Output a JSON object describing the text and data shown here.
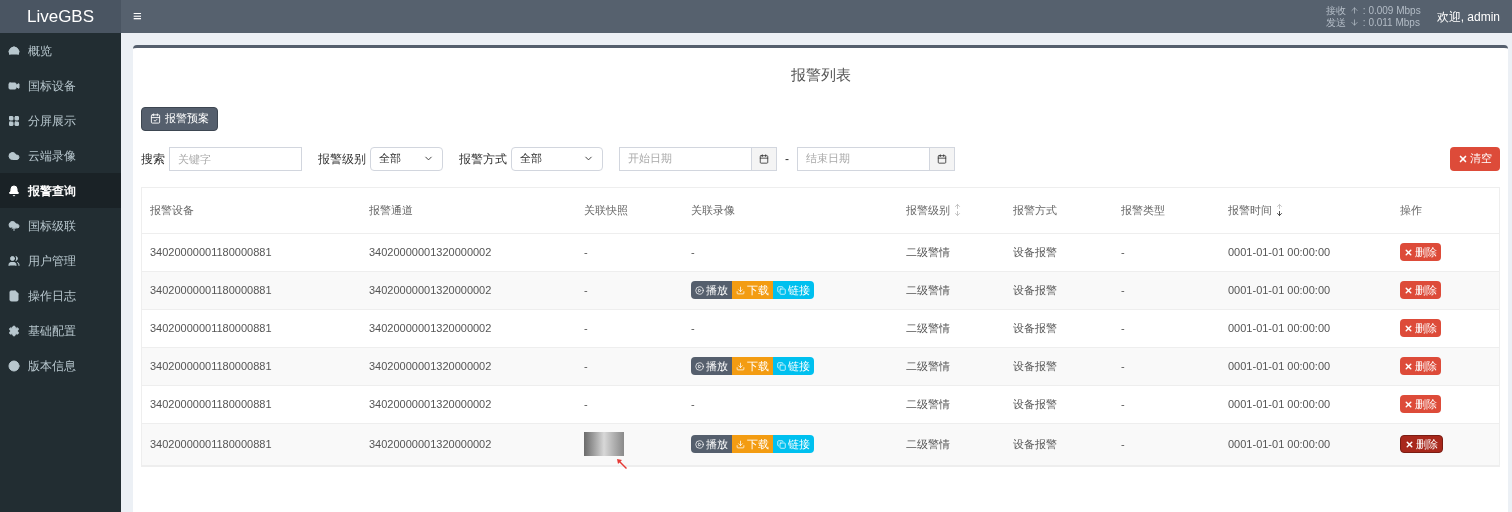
{
  "brand": "LiveGBS",
  "header": {
    "menu_icon": "≡",
    "rx_label": "接收",
    "rx_value": ": 0.009 Mbps",
    "tx_label": "发送",
    "tx_value": ": 0.011 Mbps",
    "user": "欢迎, admin"
  },
  "sidebar": {
    "items": [
      {
        "label": "概览",
        "selected": false
      },
      {
        "label": "国标设备",
        "selected": false
      },
      {
        "label": "分屏展示",
        "selected": false
      },
      {
        "label": "云端录像",
        "selected": false
      },
      {
        "label": "报警查询",
        "selected": true
      },
      {
        "label": "国标级联",
        "selected": false
      },
      {
        "label": "用户管理",
        "selected": false
      },
      {
        "label": "操作日志",
        "selected": false
      },
      {
        "label": "基础配置",
        "selected": false
      },
      {
        "label": "版本信息",
        "selected": false
      }
    ]
  },
  "page": {
    "title": "报警列表",
    "plan_button": "报警预案",
    "clear_button": "清空",
    "filters": {
      "search_label": "搜索",
      "search_placeholder": "关键字",
      "level_label": "报警级别",
      "level_value": "全部",
      "method_label": "报警方式",
      "method_value": "全部",
      "start_placeholder": "开始日期",
      "range_sep": "-",
      "end_placeholder": "结束日期"
    }
  },
  "table": {
    "columns": [
      {
        "label": "报警设备",
        "kind": "plain"
      },
      {
        "label": "报警通道",
        "kind": "plain"
      },
      {
        "label": "关联快照",
        "kind": "plain"
      },
      {
        "label": "关联录像",
        "kind": "plain"
      },
      {
        "label": "报警级别",
        "kind": "sortable"
      },
      {
        "label": "报警方式",
        "kind": "plain"
      },
      {
        "label": "报警类型",
        "kind": "plain"
      },
      {
        "label": "报警时间",
        "kind": "sorted"
      },
      {
        "label": "操作",
        "kind": "plain"
      }
    ],
    "rows": [
      {
        "device": "34020000001180000881",
        "channel": "34020000001320000002",
        "snapshot": {
          "kind": "none",
          "text": "-"
        },
        "recording": {
          "kind": "none",
          "text": "-"
        },
        "level": "二级警情",
        "method": "设备报警",
        "type": "-",
        "time": "0001-01-01 00:00:00",
        "delete": "删除",
        "delete_hover": false
      },
      {
        "device": "34020000001180000881",
        "channel": "34020000001320000002",
        "snapshot": {
          "kind": "none",
          "text": "-"
        },
        "recording": {
          "kind": "buttons",
          "play": "播放",
          "download": "下载",
          "link": "链接"
        },
        "level": "二级警情",
        "method": "设备报警",
        "type": "-",
        "time": "0001-01-01 00:00:00",
        "delete": "删除",
        "delete_hover": false
      },
      {
        "device": "34020000001180000881",
        "channel": "34020000001320000002",
        "snapshot": {
          "kind": "none",
          "text": "-"
        },
        "recording": {
          "kind": "none",
          "text": "-"
        },
        "level": "二级警情",
        "method": "设备报警",
        "type": "-",
        "time": "0001-01-01 00:00:00",
        "delete": "删除",
        "delete_hover": false
      },
      {
        "device": "34020000001180000881",
        "channel": "34020000001320000002",
        "snapshot": {
          "kind": "none",
          "text": "-"
        },
        "recording": {
          "kind": "buttons",
          "play": "播放",
          "download": "下载",
          "link": "链接"
        },
        "level": "二级警情",
        "method": "设备报警",
        "type": "-",
        "time": "0001-01-01 00:00:00",
        "delete": "删除",
        "delete_hover": false
      },
      {
        "device": "34020000001180000881",
        "channel": "34020000001320000002",
        "snapshot": {
          "kind": "none",
          "text": "-"
        },
        "recording": {
          "kind": "none",
          "text": "-"
        },
        "level": "二级警情",
        "method": "设备报警",
        "type": "-",
        "time": "0001-01-01 00:00:00",
        "delete": "删除",
        "delete_hover": false
      },
      {
        "device": "34020000001180000881",
        "channel": "34020000001320000002",
        "snapshot": {
          "kind": "image"
        },
        "recording": {
          "kind": "buttons",
          "play": "播放",
          "download": "下载",
          "link": "链接"
        },
        "level": "二级警情",
        "method": "设备报警",
        "type": "-",
        "time": "0001-01-01 00:00:00",
        "delete": "删除",
        "delete_hover": true
      }
    ]
  }
}
